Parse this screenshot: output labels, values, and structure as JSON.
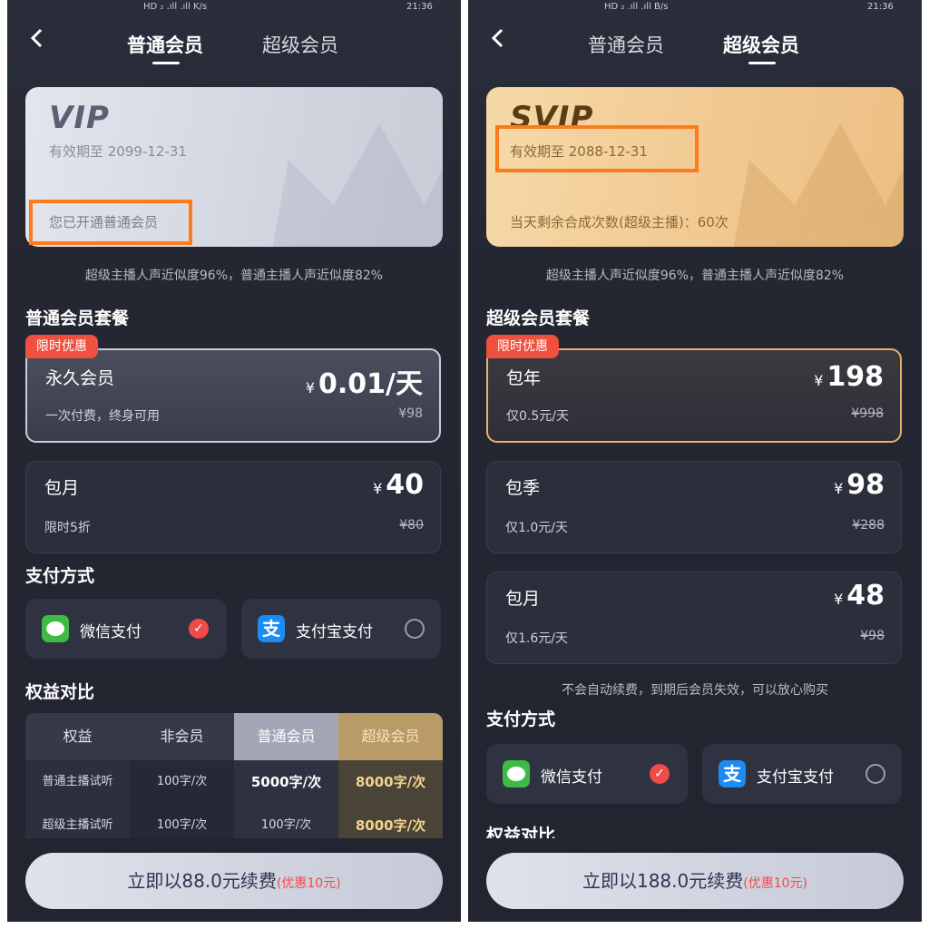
{
  "panel_left": {
    "status": {
      "left": "HD ₂ .ıll .ıll K/s",
      "right": "21:36"
    },
    "tabs": [
      {
        "label": "普通会员",
        "active": true
      },
      {
        "label": "超级会员",
        "active": false
      }
    ],
    "card": {
      "logo": "VIP",
      "expiry": "有效期至 2099-12-31",
      "status": "您已开通普通会员"
    },
    "similarity_note": "超级主播人声近似度96%，普通主播人声近似度82%",
    "plans_title": "普通会员套餐",
    "badge": "限时优惠",
    "plans": [
      {
        "name": "永久会员",
        "sub": "一次付费，终身可用",
        "yen": "¥",
        "price": "0.01/天",
        "orig": "¥98"
      },
      {
        "name": "包月",
        "sub": "限时5折",
        "yen": "¥",
        "price": "40",
        "orig": "¥80"
      }
    ],
    "payment_title": "支付方式",
    "wechat": {
      "label": "微信支付",
      "icon": "wechat-pay-icon"
    },
    "alipay": {
      "label": "支付宝支付",
      "icon": "alipay-icon",
      "glyph": "支"
    },
    "benefits_title": "权益对比",
    "table": {
      "headers": [
        "权益",
        "非会员",
        "普通会员",
        "超级会员"
      ],
      "rows": [
        [
          "普通主播试听",
          "100字/次",
          "5000字/次",
          "8000字/次"
        ],
        [
          "超级主播试听",
          "100字/次",
          "100字/次",
          "8000字/次"
        ]
      ]
    },
    "cta": {
      "label": "立即以88.0元续费",
      "discount": "(优惠10元)"
    }
  },
  "panel_right": {
    "status": {
      "left": "HD ₂ .ıll .ıll B/s",
      "right": "21:36"
    },
    "tabs": [
      {
        "label": "普通会员",
        "active": false
      },
      {
        "label": "超级会员",
        "active": true
      }
    ],
    "card": {
      "logo": "SVIP",
      "expiry": "有效期至 2088-12-31",
      "status": "当天剩余合成次数(超级主播)：60次"
    },
    "similarity_note": "超级主播人声近似度96%，普通主播人声近似度82%",
    "plans_title": "超级会员套餐",
    "badge": "限时优惠",
    "plans": [
      {
        "name": "包年",
        "sub": "仅0.5元/天",
        "yen": "¥",
        "price": "198",
        "orig": "¥998"
      },
      {
        "name": "包季",
        "sub": "仅1.0元/天",
        "yen": "¥",
        "price": "98",
        "orig": "¥288"
      },
      {
        "name": "包月",
        "sub": "仅1.6元/天",
        "yen": "¥",
        "price": "48",
        "orig": "¥98"
      }
    ],
    "renew_note": "不会自动续费，到期后会员失效，可以放心购买",
    "payment_title": "支付方式",
    "wechat": {
      "label": "微信支付",
      "icon": "wechat-pay-icon"
    },
    "alipay": {
      "label": "支付宝支付",
      "icon": "alipay-icon",
      "glyph": "支"
    },
    "benefits_title": "权益对比",
    "cta": {
      "label": "立即以188.0元续费",
      "discount": "(优惠10元)"
    }
  },
  "colors": {
    "highlight": "#ff7a1a",
    "badge": "#f0503e",
    "check": "#f04a4a",
    "wechat": "#3dbb45",
    "alipay": "#1d8cf2"
  }
}
